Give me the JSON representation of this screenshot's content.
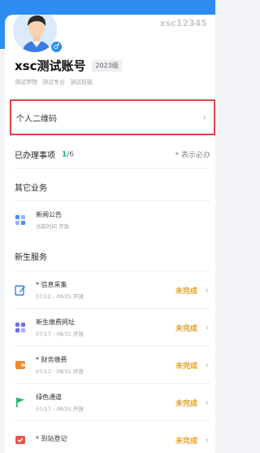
{
  "profile": {
    "student_id": "xsc12345",
    "name": "xsc测试账号",
    "grade": "2023级",
    "tags": [
      "测试学院",
      "测试专业",
      "测试班级"
    ],
    "gender_symbol": "♂"
  },
  "qr_row": {
    "label": "个人二维码"
  },
  "handled": {
    "label": "已办理事项",
    "done": "1",
    "total": "/6",
    "required_note": "* 表示必办"
  },
  "other_business": {
    "title": "其它业务",
    "items": [
      {
        "title": "新闻公告",
        "subtitle": "当前时间 开放"
      }
    ]
  },
  "new_student": {
    "title": "新生服务",
    "items": [
      {
        "title": "* 信息采集",
        "subtitle": "07/12 - 08/25 开放",
        "status": "未完成",
        "color": "#3a7be6"
      },
      {
        "title": "新生缴费网址",
        "subtitle": "07/17 - 08/31 开放",
        "status": "未完成",
        "color": "#6d6ee8"
      },
      {
        "title": "* 财务缴费",
        "subtitle": "07/17 - 08/31 开放",
        "status": "未完成",
        "color": "#f08a2b"
      },
      {
        "title": "绿色通道",
        "subtitle": "07/17 - 08/31 开放",
        "status": "未完成",
        "color": "#25b66a"
      },
      {
        "title": "* 到站登记",
        "subtitle": "",
        "status": "未完成",
        "color": "#e8534b"
      }
    ]
  }
}
